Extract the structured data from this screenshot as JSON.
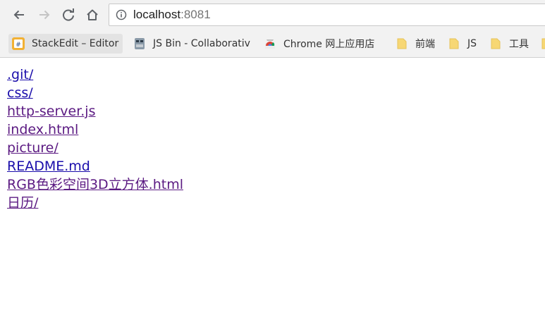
{
  "browser": {
    "url_host": "localhost",
    "url_port": ":8081",
    "nav_icons": [
      "back-arrow-icon",
      "forward-arrow-icon",
      "reload-icon",
      "home-icon"
    ],
    "info_icon": "info-circle-icon"
  },
  "bookmarks": [
    {
      "label": "StackEdit – Editor",
      "icon": "stackedit-icon"
    },
    {
      "label": "JS Bin - Collaborativ",
      "icon": "jsbin-icon"
    },
    {
      "label": "Chrome 网上应用店",
      "icon": "chrome-webstore-icon"
    },
    {
      "label": "前端",
      "icon": "folder-icon"
    },
    {
      "label": "JS",
      "icon": "folder-icon"
    },
    {
      "label": "工具",
      "icon": "folder-icon"
    }
  ],
  "listing": [
    {
      "name": ".git/",
      "visited": false
    },
    {
      "name": "css/",
      "visited": false
    },
    {
      "name": "http-server.js",
      "visited": true
    },
    {
      "name": "index.html",
      "visited": true
    },
    {
      "name": "picture/",
      "visited": true
    },
    {
      "name": "README.md",
      "visited": false
    },
    {
      "name": "RGB色彩空间3D立方体.html",
      "visited": true
    },
    {
      "name": "日历/",
      "visited": true
    }
  ],
  "colors": {
    "link": "#1a0dab",
    "link_visited": "#5b1a82",
    "folder": "#f7d774",
    "toolbar": "#f2f2f2"
  }
}
